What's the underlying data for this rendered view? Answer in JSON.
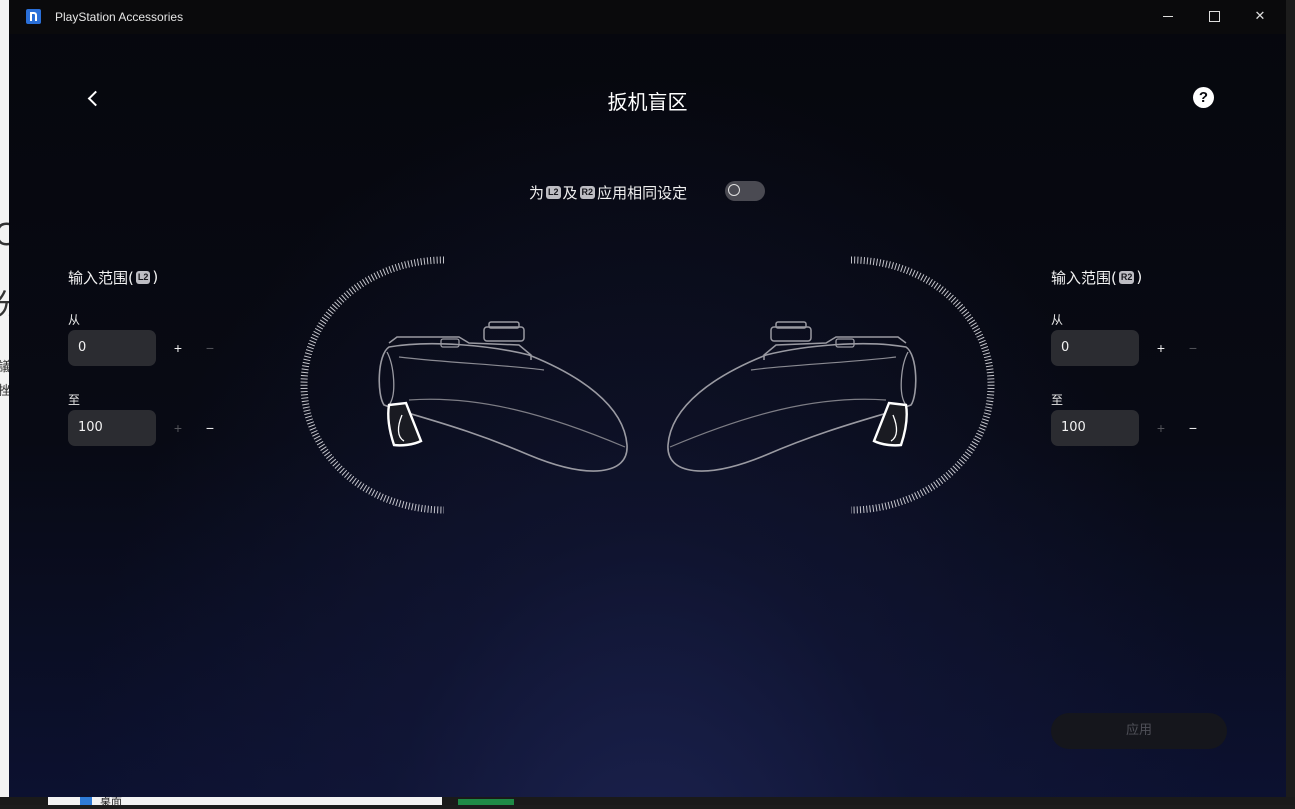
{
  "window": {
    "title": "PlayStation Accessories"
  },
  "header": {
    "page_title": "扳机盲区"
  },
  "same_settings": {
    "label_prefix": "为",
    "badge_left": "L2",
    "label_middle": "及",
    "badge_right": "R2",
    "label_suffix": "应用相同设定",
    "enabled": false
  },
  "left_panel": {
    "title_prefix": "输入范围(",
    "trigger_badge": "L2",
    "title_suffix": ")",
    "from_label": "从",
    "from_value": "0",
    "to_label": "至",
    "to_value": "100",
    "plus": "+",
    "minus": "−"
  },
  "right_panel": {
    "title_prefix": "输入范围(",
    "trigger_badge": "R2",
    "title_suffix": ")",
    "from_label": "从",
    "from_value": "0",
    "to_label": "至",
    "to_value": "100",
    "plus": "+",
    "minus": "−"
  },
  "footer": {
    "apply_label": "应用"
  },
  "desktop": {
    "taskbar_text": "桌面"
  },
  "colors": {
    "background": "#06070d",
    "field": "#2b2c31",
    "apply_disabled": "#15161c"
  },
  "icons": [
    "app-icon",
    "back-icon",
    "help-icon",
    "controller-left-illustration",
    "controller-right-illustration"
  ]
}
